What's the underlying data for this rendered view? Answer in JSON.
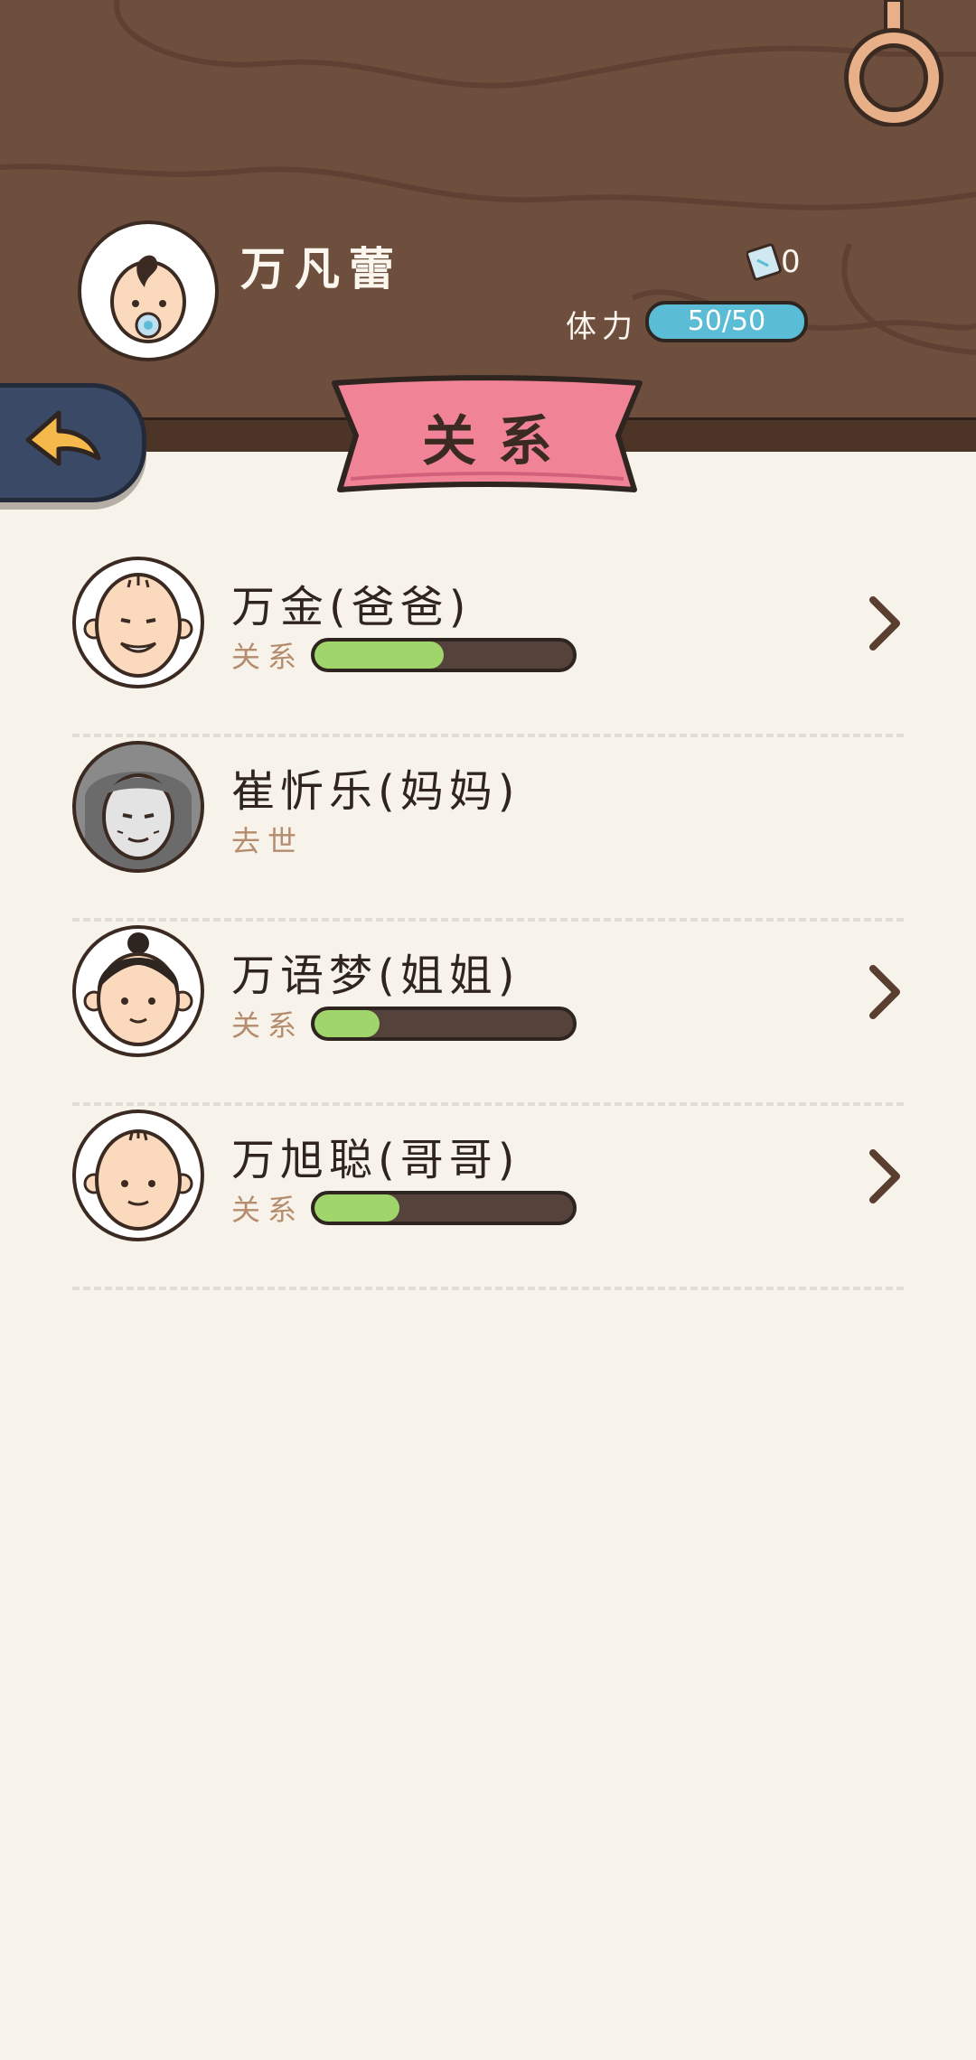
{
  "player": {
    "name": "万凡蕾",
    "tickets": "0",
    "stamina_label": "体力",
    "stamina": "50/50"
  },
  "page": {
    "title": "关系"
  },
  "relations": [
    {
      "name": "万金(爸爸)",
      "label": "关系",
      "level": 0.5,
      "has_arrow": true,
      "status": ""
    },
    {
      "name": "崔忻乐(妈妈)",
      "label": "",
      "level": 0,
      "has_arrow": false,
      "status": "去世"
    },
    {
      "name": "万语梦(姐姐)",
      "label": "关系",
      "level": 0.25,
      "has_arrow": true,
      "status": ""
    },
    {
      "name": "万旭聪(哥哥)",
      "label": "关系",
      "level": 0.33,
      "has_arrow": true,
      "status": ""
    }
  ],
  "colors": {
    "wood": "#6e4f3e",
    "banner": "#f08496",
    "stamina": "#5bbcd6",
    "relation_fill": "#9fd56a",
    "back_arrow": "#f5b84a"
  },
  "icons": [
    "hook-ring-icon",
    "baby-avatar-icon",
    "ticket-icon",
    "back-arrow-icon",
    "chevron-right-icon"
  ]
}
